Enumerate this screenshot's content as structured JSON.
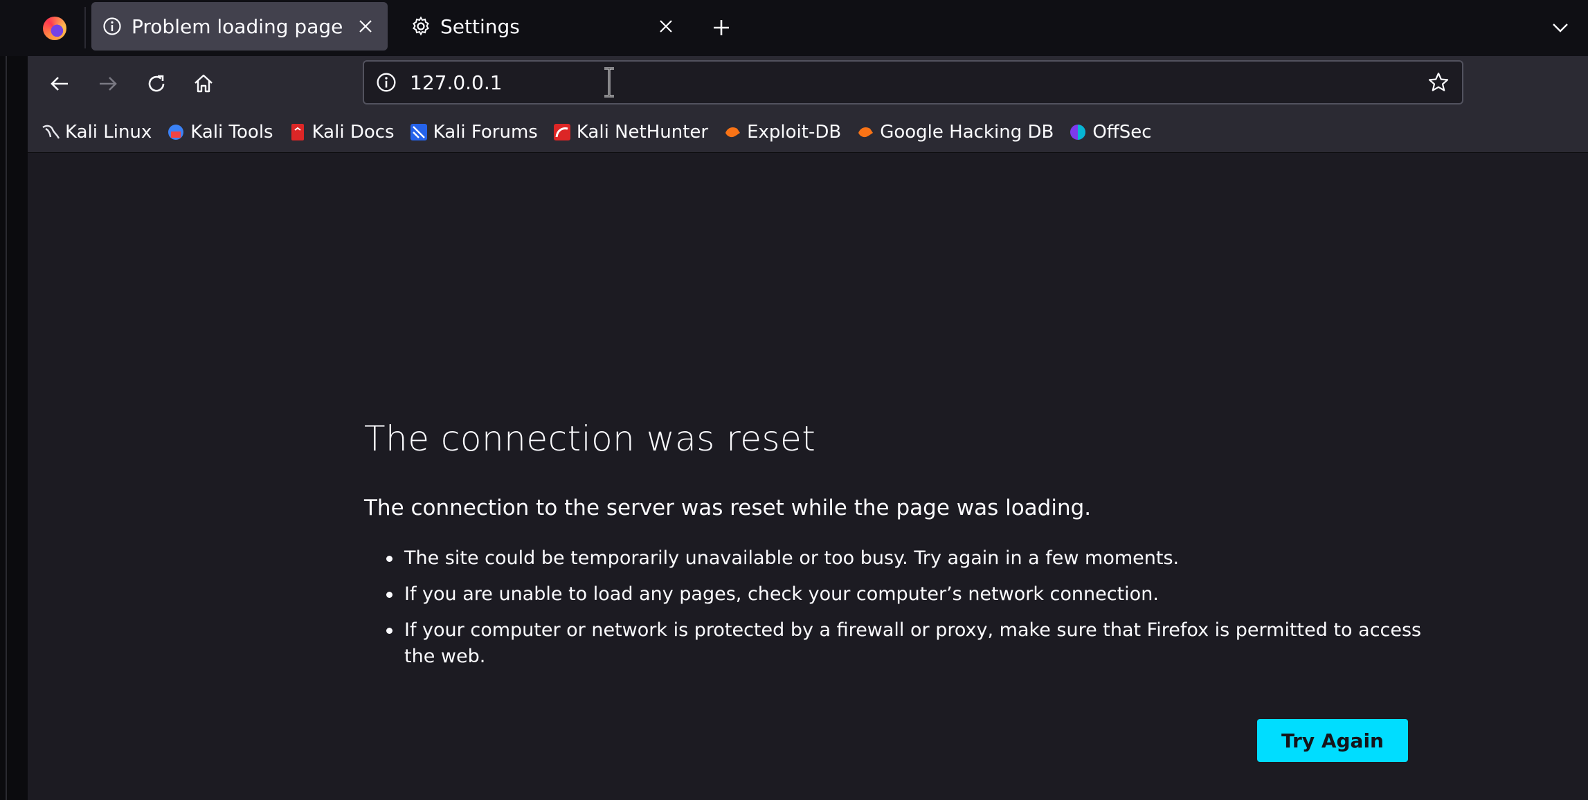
{
  "tabs": [
    {
      "label": "Problem loading page",
      "icon": "info-icon",
      "active": true
    },
    {
      "label": "Settings",
      "icon": "gear-icon",
      "active": false
    }
  ],
  "urlbar": {
    "url": "127.0.0.1"
  },
  "bookmarks": [
    {
      "label": "Kali Linux",
      "icon": "kali-dragon-icon"
    },
    {
      "label": "Kali Tools",
      "icon": "kali-tools-icon"
    },
    {
      "label": "Kali Docs",
      "icon": "kali-docs-icon"
    },
    {
      "label": "Kali Forums",
      "icon": "kali-forums-icon"
    },
    {
      "label": "Kali NetHunter",
      "icon": "nethunter-icon"
    },
    {
      "label": "Exploit-DB",
      "icon": "exploit-db-icon"
    },
    {
      "label": "Google Hacking DB",
      "icon": "ghdb-icon"
    },
    {
      "label": "OffSec",
      "icon": "offsec-icon"
    }
  ],
  "error": {
    "title": "The connection was reset",
    "description": "The connection to the server was reset while the page was loading.",
    "items": [
      "The site could be temporarily unavailable or too busy. Try again in a few moments.",
      "If you are unable to load any pages, check your computer’s network connection.",
      "If your computer or network is protected by a firewall or proxy, make sure that Firefox is permitted to access the web."
    ],
    "button_label": "Try Again"
  },
  "colors": {
    "accent": "#00ddff",
    "background": "#1c1b22",
    "toolbar": "#2b2a33"
  }
}
